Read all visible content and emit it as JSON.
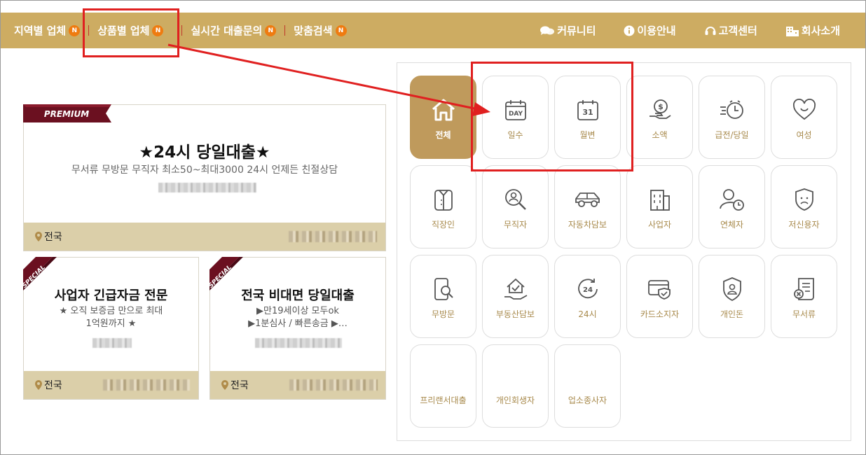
{
  "nav": {
    "left": [
      {
        "label": "지역별 업체",
        "badge": "N"
      },
      {
        "label": "상품별 업체",
        "badge": "N"
      },
      {
        "label": "실시간 대출문의",
        "badge": "N"
      },
      {
        "label": "맞춤검색",
        "badge": "N"
      }
    ],
    "right": [
      {
        "label": "커뮤니티",
        "icon": "chat-icon"
      },
      {
        "label": "이용안내",
        "icon": "info-icon"
      },
      {
        "label": "고객센터",
        "icon": "headset-icon"
      },
      {
        "label": "회사소개",
        "icon": "building-icon"
      }
    ]
  },
  "premium": {
    "ribbon": "PREMIUM",
    "title": "★24시 당일대출★",
    "subtitle": "무서류 무방문 무직자 최소50~최대3000 24시 언제든 친절상담",
    "region": "전국"
  },
  "specials": [
    {
      "ribbon": "SPECIAL",
      "title": "사업자 긴급자금 전문",
      "line1": "★ 오직 보증금 만으로 최대",
      "line2": "1억원까지 ★",
      "region": "전국"
    },
    {
      "ribbon": "SPECIAL",
      "title": "전국 비대면 당일대출",
      "line1": "▶만19세이상 모두ok",
      "line2": "▶1분심사 / 빠른송금 ▶…",
      "region": "전국"
    }
  ],
  "categories": [
    {
      "label": "전체",
      "icon": "home-icon",
      "active": true
    },
    {
      "label": "일수",
      "icon": "calendar-day-icon"
    },
    {
      "label": "월변",
      "icon": "calendar-31-icon"
    },
    {
      "label": "소액",
      "icon": "money-hand-icon"
    },
    {
      "label": "급전/당일",
      "icon": "fast-clock-icon"
    },
    {
      "label": "여성",
      "icon": "heart-icon"
    },
    {
      "label": "직장인",
      "icon": "shirt-icon"
    },
    {
      "label": "무직자",
      "icon": "person-search-icon"
    },
    {
      "label": "자동차담보",
      "icon": "car-icon"
    },
    {
      "label": "사업자",
      "icon": "office-building-icon"
    },
    {
      "label": "연체자",
      "icon": "person-clock-icon"
    },
    {
      "label": "저신용자",
      "icon": "sad-shield-icon"
    },
    {
      "label": "무방문",
      "icon": "phone-search-icon"
    },
    {
      "label": "부동산담보",
      "icon": "house-hand-icon"
    },
    {
      "label": "24시",
      "icon": "clock-24-icon"
    },
    {
      "label": "카드소지자",
      "icon": "card-shield-icon"
    },
    {
      "label": "개인돈",
      "icon": "person-badge-icon"
    },
    {
      "label": "무서류",
      "icon": "document-x-icon"
    },
    {
      "label": "프리랜서대출",
      "icon": ""
    },
    {
      "label": "개인회생자",
      "icon": ""
    },
    {
      "label": "업소종사자",
      "icon": ""
    }
  ],
  "colors": {
    "nav_bg": "#cdac62",
    "badge": "#ef7b10",
    "accent": "#bf9a5c",
    "label": "#a88a4c",
    "annotation": "#e02020"
  }
}
